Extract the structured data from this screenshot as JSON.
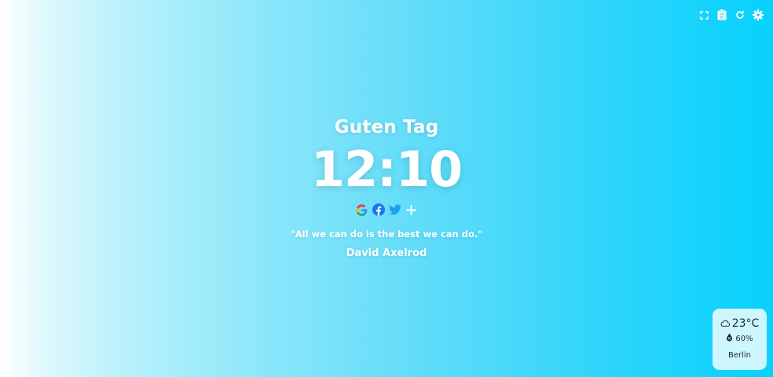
{
  "toolbar": {
    "icons": [
      "fullscreen-icon",
      "clipboard-icon",
      "refresh-icon",
      "gear-icon"
    ]
  },
  "greeting": "Guten Tag",
  "clock": "12:10",
  "shortcuts": [
    {
      "name": "google",
      "icon": "google-icon"
    },
    {
      "name": "facebook",
      "icon": "facebook-icon"
    },
    {
      "name": "twitter",
      "icon": "twitter-icon"
    },
    {
      "name": "add",
      "icon": "plus-icon"
    }
  ],
  "quote": {
    "text": "\"All we can do is the best we can do.\"",
    "author": "David Axelrod"
  },
  "weather": {
    "temperature": "23°C",
    "humidity": "60%",
    "city": "Berlin",
    "icon": "cloud-icon",
    "humidity_icon": "humidity-drop-icon"
  },
  "colors": {
    "gradient_start": "#ffffff",
    "gradient_end": "#06d1fc",
    "text": "#ffffff"
  }
}
